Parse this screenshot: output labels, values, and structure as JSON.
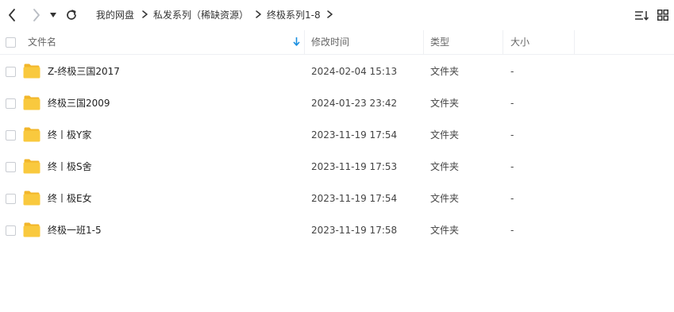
{
  "breadcrumb": [
    {
      "label": "我的网盘"
    },
    {
      "label": "私发系列（稀缺资源）"
    },
    {
      "label": "终极系列1-8"
    }
  ],
  "columns": {
    "name": "文件名",
    "modified": "修改时间",
    "type": "类型",
    "size": "大小"
  },
  "files": [
    {
      "name": "Z-终极三国2017",
      "modified": "2024-02-04 15:13",
      "type": "文件夹",
      "size": "-"
    },
    {
      "name": "终极三国2009",
      "modified": "2024-01-23 23:42",
      "type": "文件夹",
      "size": "-"
    },
    {
      "name": "终丨极Y家",
      "modified": "2023-11-19 17:54",
      "type": "文件夹",
      "size": "-"
    },
    {
      "name": "终丨极S舍",
      "modified": "2023-11-19 17:53",
      "type": "文件夹",
      "size": "-"
    },
    {
      "name": "终丨极E女",
      "modified": "2023-11-19 17:54",
      "type": "文件夹",
      "size": "-"
    },
    {
      "name": "终极一班1-5",
      "modified": "2023-11-19 17:58",
      "type": "文件夹",
      "size": "-"
    }
  ],
  "icons": {
    "back": "chevron-left-icon",
    "forward": "chevron-right-icon",
    "history": "caret-down-icon",
    "refresh": "refresh-icon",
    "sort_list": "sort-list-icon",
    "grid_view": "grid-view-icon",
    "sort_indicator": "sort-down-arrow-icon",
    "folder": "folder-icon"
  },
  "colors": {
    "accent": "#1a8fe0",
    "folder": "#f9c93e",
    "folder_tab": "#f2b62a",
    "border": "#eef0f3"
  }
}
